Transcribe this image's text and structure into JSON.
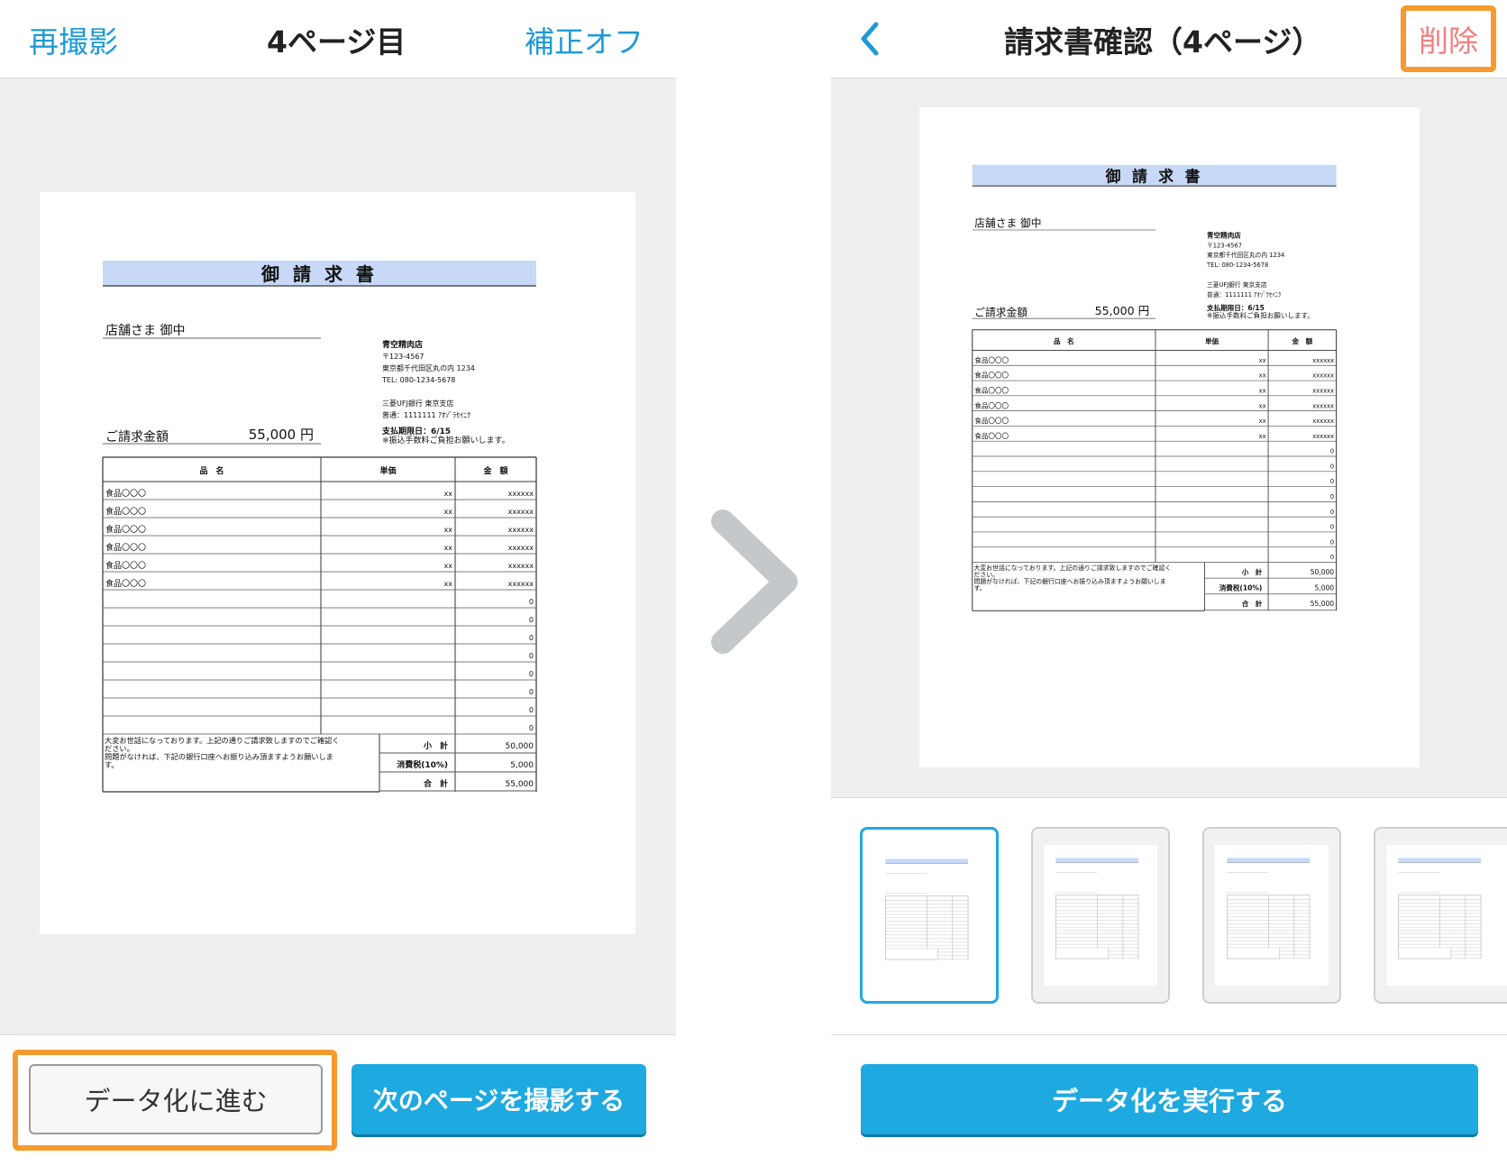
{
  "left": {
    "header": {
      "retake": "再撮影",
      "title": "4ページ目",
      "correction": "補正オフ"
    },
    "buttons": {
      "proceed": "データ化に進む",
      "next_page": "次のページを撮影する"
    }
  },
  "right": {
    "header": {
      "title": "請求書確認（4ページ）",
      "delete": "削除"
    },
    "execute": "データ化を実行する"
  },
  "invoice": {
    "title": "御 請 求 書",
    "recipient": "店舗さま  御中",
    "amount_label": "ご請求金額",
    "amount_value": "55,000 円",
    "issuer": {
      "name": "青空精肉店",
      "postal": "〒123-4567",
      "address": "東京都千代田区丸の内 1234",
      "tel": "TEL: 080-1234-5678",
      "bank": "三菱UFJ銀行 東京支店",
      "account": "普通：1111111 ｱｵｿﾞﾗｾｲﾆｸ",
      "due": "支払期限日：6/15",
      "fee_note": "※振込手数料ご負担お願いします。"
    },
    "columns": [
      "品　名",
      "単価",
      "金　額"
    ],
    "rows": [
      {
        "item": "食品〇〇〇",
        "price": "xx",
        "amount": "xxxxxx"
      },
      {
        "item": "食品〇〇〇",
        "price": "xx",
        "amount": "xxxxxx"
      },
      {
        "item": "食品〇〇〇",
        "price": "xx",
        "amount": "xxxxxx"
      },
      {
        "item": "食品〇〇〇",
        "price": "xx",
        "amount": "xxxxxx"
      },
      {
        "item": "食品〇〇〇",
        "price": "xx",
        "amount": "xxxxxx"
      },
      {
        "item": "食品〇〇〇",
        "price": "xx",
        "amount": "xxxxxx"
      },
      {
        "item": "",
        "price": "",
        "amount": "0"
      },
      {
        "item": "",
        "price": "",
        "amount": "0"
      },
      {
        "item": "",
        "price": "",
        "amount": "0"
      },
      {
        "item": "",
        "price": "",
        "amount": "0"
      },
      {
        "item": "",
        "price": "",
        "amount": "0"
      },
      {
        "item": "",
        "price": "",
        "amount": "0"
      },
      {
        "item": "",
        "price": "",
        "amount": "0"
      },
      {
        "item": "",
        "price": "",
        "amount": "0"
      }
    ],
    "note_lines": [
      "大変お世話になっております。上記の通りご請求致しますのでご確認く",
      "ださい。",
      "問題がなければ、下記の銀行口座へお振り込み頂ますようお願いしま",
      "す。"
    ],
    "summary": [
      {
        "label": "小　計",
        "value": "50,000"
      },
      {
        "label": "消費税(10%)",
        "value": "5,000"
      },
      {
        "label": "合　計",
        "value": "55,000"
      }
    ]
  }
}
